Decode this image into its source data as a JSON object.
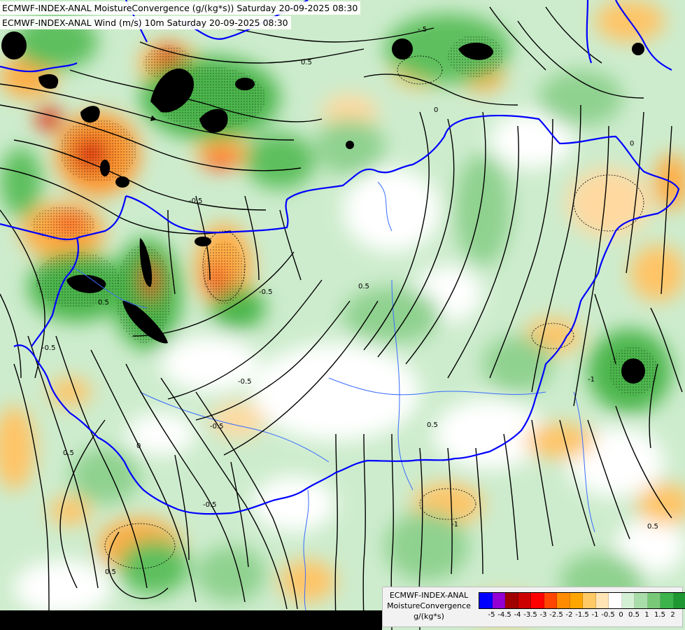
{
  "header": {
    "title_line_1": "ECMWF-INDEX-ANAL MoistureConvergence (g/(kg*s)) Saturday 20-09-2025 08:30",
    "title_line_2": "ECMWF-INDEX-ANAL Wind (m/s) 10m Saturday 20-09-2025 08:30"
  },
  "legend": {
    "line_1": "ECMWF-INDEX-ANAL",
    "line_2": "MoistureConvergence",
    "line_3": "g/(kg*s)",
    "colors": [
      "#0000ff",
      "#9400d3",
      "#a00000",
      "#cc0000",
      "#ff0000",
      "#ff4500",
      "#ff8c00",
      "#ffa500",
      "#ffc966",
      "#ffe4b5",
      "#ffffff",
      "#d4f0d4",
      "#a8dca8",
      "#78c878",
      "#3cb44b",
      "#1e9632"
    ],
    "ticks": [
      "-5",
      "-4.5",
      "-4",
      "-3.5",
      "-3",
      "-2.5",
      "-2",
      "-1.5",
      "-1",
      "-0.5",
      "0",
      "0.5",
      "1",
      "1.5",
      "2"
    ]
  },
  "map": {
    "contour_labels": [
      "-.5",
      "0.5",
      "0",
      "-0.5",
      "-0.5",
      "0.5",
      "0.5",
      "-0.5",
      "0.5",
      "0",
      "0.5",
      "-0.5",
      "0.5",
      "-1",
      "-0.5",
      "0.5",
      "0",
      "-0.5",
      "-1"
    ],
    "field_colors": {
      "white": "#ffffff",
      "light_green": "#cdeccd",
      "mid_green": "#8fd18f",
      "green": "#4cb64c",
      "dark_green": "#1e8c32",
      "black": "#000000",
      "light_orange": "#ffd9a0",
      "orange": "#ffad45",
      "dark_orange": "#ff7a1a",
      "red": "#e03010",
      "border_blue": "#0000ff",
      "river_blue": "#3a6cff",
      "streamline": "#000000"
    }
  }
}
